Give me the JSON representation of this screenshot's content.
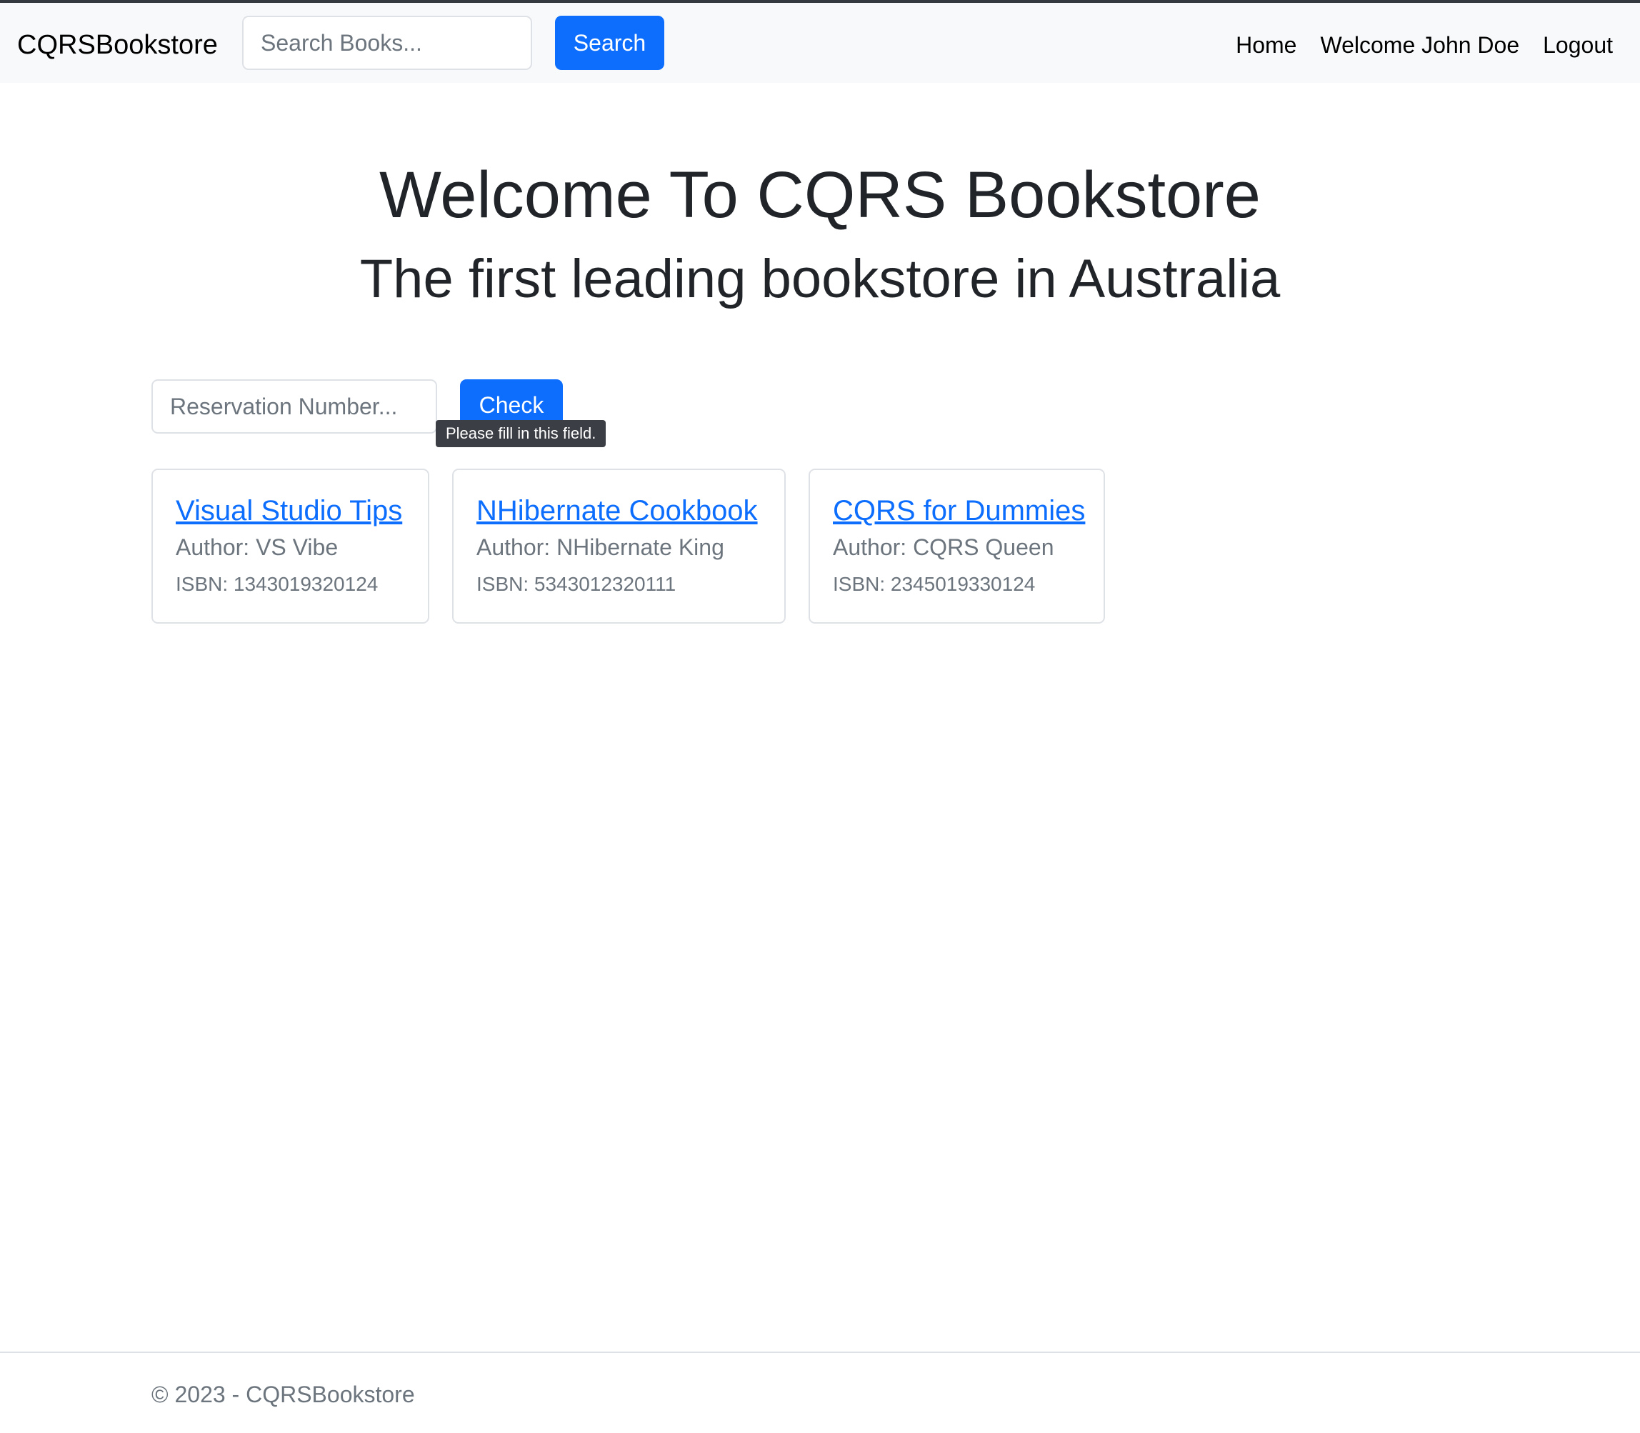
{
  "navbar": {
    "brand": "CQRSBookstore",
    "search_placeholder": "Search Books...",
    "search_button": "Search",
    "links": [
      "Home",
      "Welcome John Doe",
      "Logout"
    ]
  },
  "hero": {
    "title": "Welcome To CQRS Bookstore",
    "subtitle": "The first leading bookstore in Australia"
  },
  "reservation": {
    "placeholder": "Reservation Number...",
    "check_button": "Check",
    "validation_tooltip": "Please fill in this field."
  },
  "books": [
    {
      "title": "Visual Studio Tips",
      "author": "Author: VS Vibe",
      "isbn": "ISBN: 1343019320124"
    },
    {
      "title": "NHibernate Cookbook",
      "author": "Author: NHibernate King",
      "isbn": "ISBN: 5343012320111"
    },
    {
      "title": "CQRS for Dummies",
      "author": "Author: CQRS Queen",
      "isbn": "ISBN: 2345019330124"
    }
  ],
  "footer": {
    "text": "© 2023 - CQRSBookstore"
  },
  "colors": {
    "primary": "#0d6efd",
    "navbar_bg": "#f8f9fa",
    "muted": "#6c757d"
  }
}
